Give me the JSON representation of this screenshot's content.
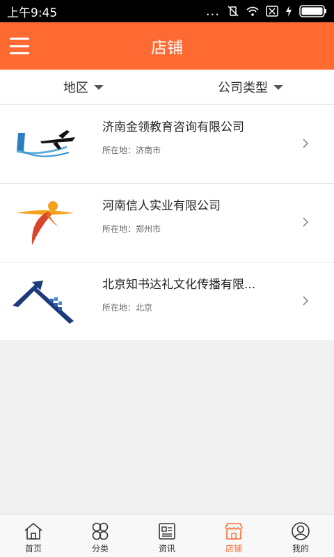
{
  "status_bar": {
    "time": "上午9:45",
    "dots": "..."
  },
  "header": {
    "title": "店铺"
  },
  "filters": [
    {
      "label": "地区"
    },
    {
      "label": "公司类型"
    }
  ],
  "stores": [
    {
      "name": "济南金领教育咨询有限公司",
      "location": "所在地：济南市"
    },
    {
      "name": "河南信人实业有限公司",
      "location": "所在地：郑州市"
    },
    {
      "name": "北京知书达礼文化传播有限...",
      "location": "所在地：北京"
    }
  ],
  "tabs": [
    {
      "label": "首页",
      "icon": "home-icon"
    },
    {
      "label": "分类",
      "icon": "category-icon"
    },
    {
      "label": "资讯",
      "icon": "news-icon"
    },
    {
      "label": "店铺",
      "icon": "store-icon",
      "active": true
    },
    {
      "label": "我的",
      "icon": "profile-icon"
    }
  ],
  "colors": {
    "accent": "#ff6a33",
    "status_bar": "#000000"
  }
}
